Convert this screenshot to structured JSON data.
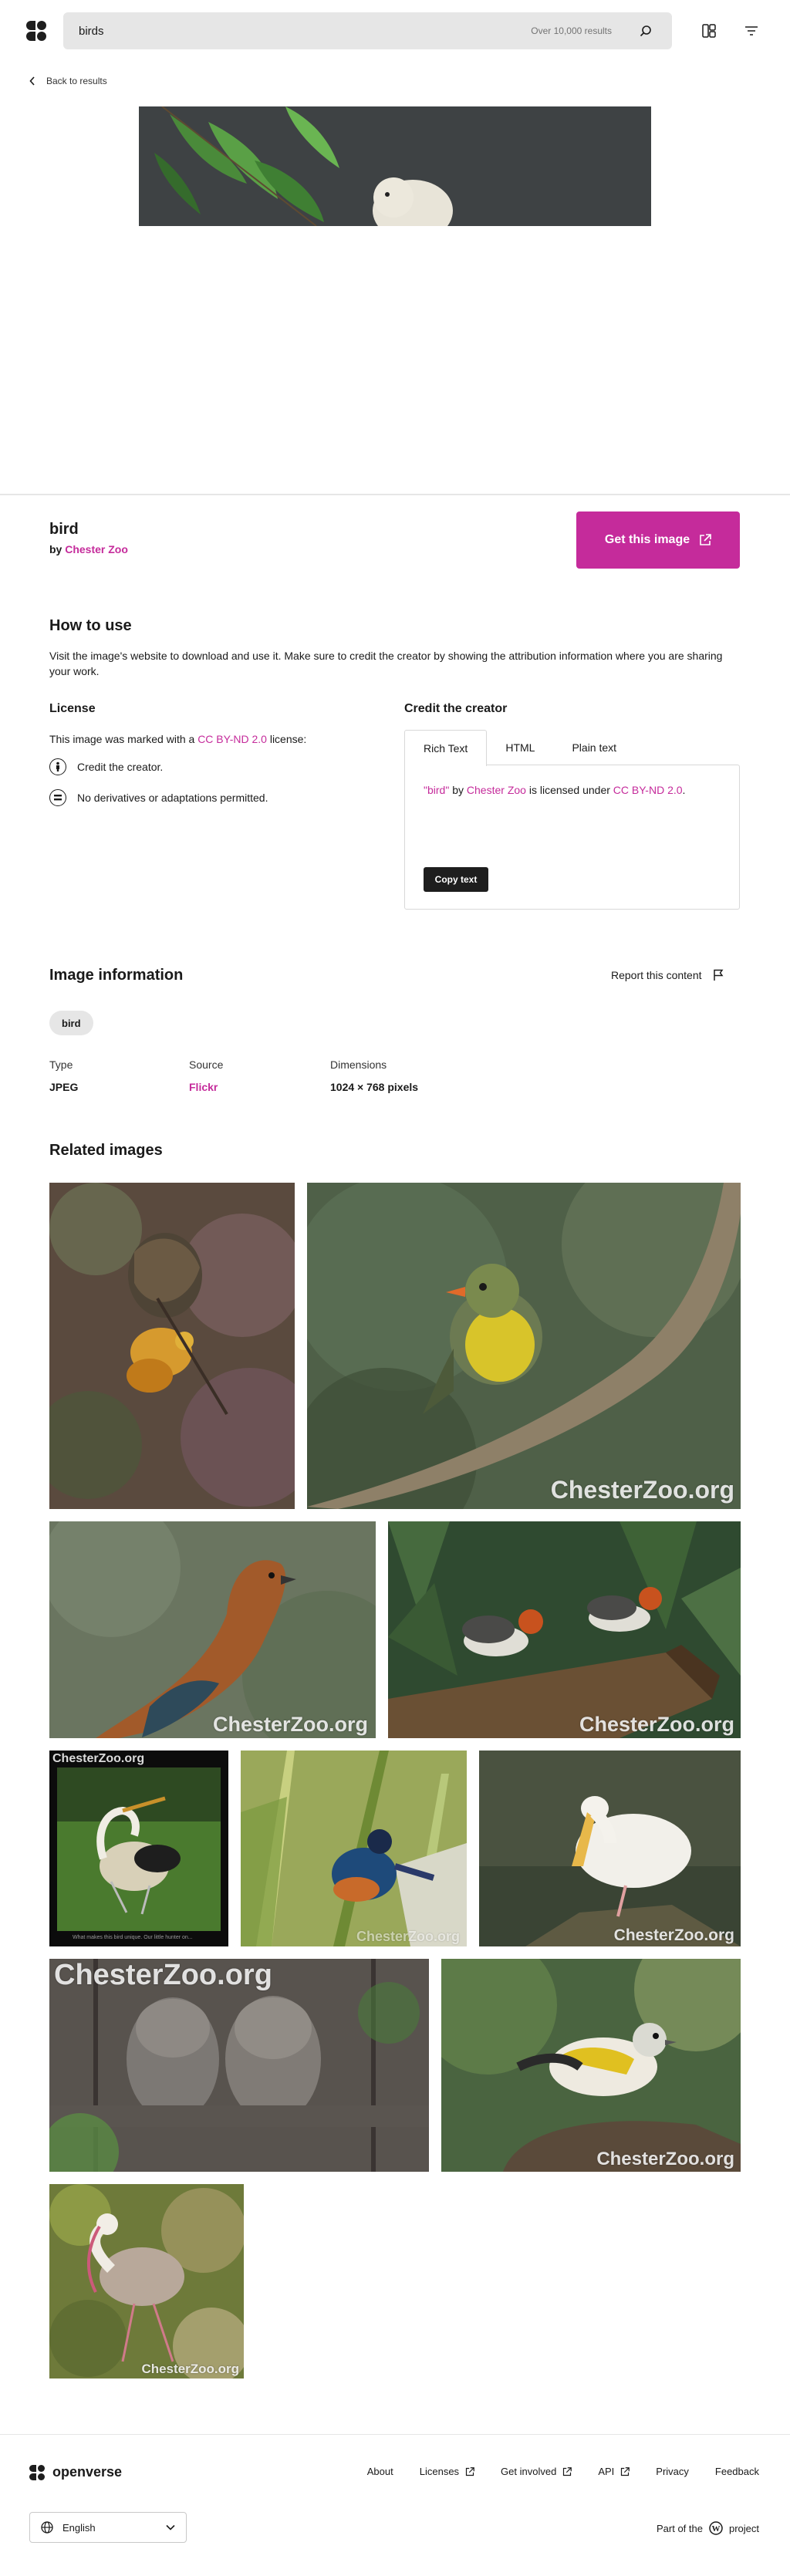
{
  "header": {
    "search_value": "birds",
    "result_count": "Over 10,000 results"
  },
  "back_link": "Back to results",
  "image": {
    "title": "bird",
    "by": "by",
    "creator": "Chester Zoo",
    "get_button": "Get this image"
  },
  "how_to_use": {
    "heading": "How to use",
    "text": "Visit the image's website to download and use it. Make sure to credit the creator by showing the attribution information where you are sharing your work."
  },
  "license": {
    "heading": "License",
    "prefix": "This image was marked with a",
    "name": "CC BY-ND 2.0",
    "suffix": "license:",
    "items": [
      "Credit the creator.",
      "No derivatives or adaptations permitted."
    ]
  },
  "credit": {
    "heading": "Credit the creator",
    "tabs": [
      "Rich Text",
      "HTML",
      "Plain text"
    ],
    "active_tab": "Rich Text",
    "quote_open": "\"",
    "work": "bird",
    "quote_close": "\"",
    "by": "by",
    "creator": "Chester Zoo",
    "licensed_under": "is licensed under",
    "license": "CC BY-ND 2.0",
    "end": ".",
    "copy_button": "Copy text"
  },
  "image_info": {
    "heading": "Image information",
    "report": "Report this content",
    "tag": "bird",
    "type_label": "Type",
    "type_value": "JPEG",
    "source_label": "Source",
    "source_value": "Flickr",
    "dimensions_label": "Dimensions",
    "dimensions_value": "1024 × 768 pixels"
  },
  "related": {
    "heading": "Related images",
    "watermark": "ChesterZoo.org",
    "caption_small": "What makes this bird unique. Our little hunter on..."
  },
  "footer": {
    "brand": "openverse",
    "nav": [
      "About",
      "Licenses",
      "Get involved",
      "API",
      "Privacy",
      "Feedback"
    ],
    "language": "English",
    "part_of": "Part of the",
    "project": "project"
  },
  "colors": {
    "accent": "#c52b9b",
    "dark": "#1e1e1e",
    "surface": "#e6e6e6"
  }
}
